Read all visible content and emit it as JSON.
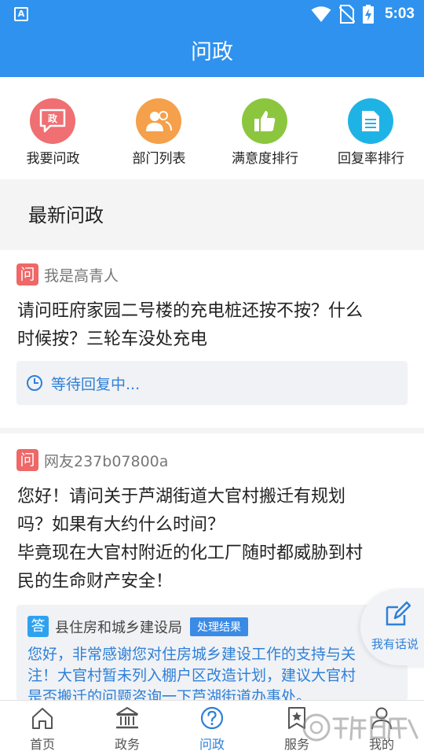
{
  "status_bar": {
    "time": "5:03",
    "icons": [
      "accessibility-a-icon",
      "wifi-icon",
      "no-sim-icon",
      "battery-charging-icon"
    ]
  },
  "title": "问政",
  "shortcuts": [
    {
      "label": "我要问政",
      "icon": "ask-gov-icon",
      "color": "#ef6f72"
    },
    {
      "label": "部门列表",
      "icon": "people-icon",
      "color": "#f5a04a"
    },
    {
      "label": "满意度排行",
      "icon": "thumbs-up-icon",
      "color": "#8cc63f"
    },
    {
      "label": "回复率排行",
      "icon": "document-icon",
      "color": "#1fb3e5"
    }
  ],
  "section_title": "最新问政",
  "posts": [
    {
      "badge": "问",
      "asker": "我是高青人",
      "question_lines": [
        "请问旺府家园二号楼的充电桩还按不按？什么",
        "时候按？三轮车没处充电"
      ],
      "status": "等待回复中..."
    },
    {
      "badge": "问",
      "asker": "网友237b07800a",
      "question_lines": [
        "您好！请问关于芦湖街道大官村搬迁有规划",
        "吗？如果有大约什么时间？",
        "毕竟现在大官村附近的化工厂随时都威胁到村",
        "民的生命财产安全！"
      ],
      "answer": {
        "badge": "答",
        "department": "县住房和城乡建设局",
        "tag": "处理结果",
        "text_lines": [
          "您好，非常感谢您对住房城乡建设工作的支持与关",
          "注！大官村暂未列入棚户区改造计划，建议大官村",
          "是否搬迁的问题咨询一下芦湖街道办事处。"
        ]
      }
    }
  ],
  "fab_label": "我有话说",
  "bottom_nav": [
    {
      "label": "首页",
      "icon": "home-icon",
      "active": false
    },
    {
      "label": "政务",
      "icon": "government-building-icon",
      "active": false
    },
    {
      "label": "问政",
      "icon": "question-circle-icon",
      "active": true
    },
    {
      "label": "服务",
      "icon": "service-star-icon",
      "active": false
    },
    {
      "label": "我的",
      "icon": "user-icon",
      "active": false
    }
  ],
  "colors": {
    "primary": "#2f92ee",
    "link_blue": "#2f80d8",
    "question_badge": "#ef6767",
    "answer_badge": "#2fa2ef"
  }
}
